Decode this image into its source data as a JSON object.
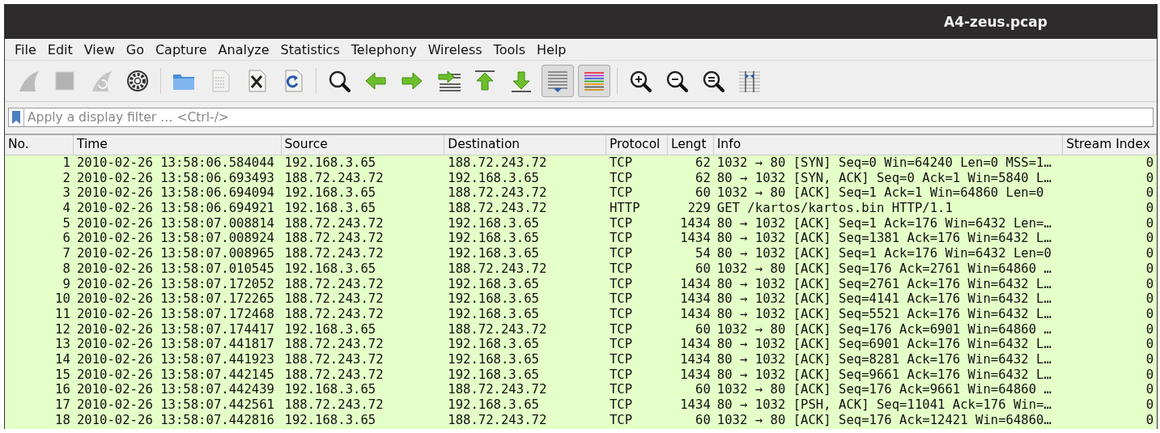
{
  "window": {
    "title": "A4-zeus.pcap"
  },
  "menu": [
    "File",
    "Edit",
    "View",
    "Go",
    "Capture",
    "Analyze",
    "Statistics",
    "Telephony",
    "Wireless",
    "Tools",
    "Help"
  ],
  "toolbar": [
    {
      "kind": "fin",
      "disabled": true,
      "on": false
    },
    {
      "kind": "stop",
      "disabled": true,
      "on": false
    },
    {
      "kind": "restart",
      "disabled": true,
      "on": false
    },
    {
      "kind": "gear",
      "disabled": false,
      "on": false
    },
    {
      "kind": "separator"
    },
    {
      "kind": "folder",
      "disabled": false,
      "on": false
    },
    {
      "kind": "file",
      "disabled": true,
      "on": false
    },
    {
      "kind": "close",
      "disabled": false,
      "on": false
    },
    {
      "kind": "reload",
      "disabled": false,
      "on": false
    },
    {
      "kind": "separator"
    },
    {
      "kind": "search",
      "disabled": false,
      "on": false
    },
    {
      "kind": "back",
      "disabled": false,
      "on": false
    },
    {
      "kind": "forward",
      "disabled": false,
      "on": false
    },
    {
      "kind": "jump",
      "disabled": false,
      "on": false
    },
    {
      "kind": "first",
      "disabled": false,
      "on": false
    },
    {
      "kind": "last",
      "disabled": false,
      "on": false
    },
    {
      "kind": "autoscroll",
      "disabled": false,
      "on": true
    },
    {
      "kind": "colorize",
      "disabled": false,
      "on": true
    },
    {
      "kind": "separator"
    },
    {
      "kind": "zoomin",
      "disabled": false,
      "on": false
    },
    {
      "kind": "zoomout",
      "disabled": false,
      "on": false
    },
    {
      "kind": "zoomreset",
      "disabled": false,
      "on": false
    },
    {
      "kind": "columns",
      "disabled": false,
      "on": false
    }
  ],
  "filter": {
    "placeholder": "Apply a display filter … <Ctrl-/>"
  },
  "table": {
    "columns": [
      "No.",
      "Time",
      "Source",
      "Destination",
      "Protocol",
      "Lengt",
      "Info",
      "Stream Index"
    ],
    "rows": [
      [
        "1",
        "2010-02-26 13:58:06.584044",
        "192.168.3.65",
        "188.72.243.72",
        "TCP",
        "62",
        "1032 → 80 [SYN] Seq=0 Win=64240 Len=0 MSS=1…",
        "0"
      ],
      [
        "2",
        "2010-02-26 13:58:06.693493",
        "188.72.243.72",
        "192.168.3.65",
        "TCP",
        "62",
        "80 → 1032 [SYN, ACK] Seq=0 Ack=1 Win=5840 L…",
        "0"
      ],
      [
        "3",
        "2010-02-26 13:58:06.694094",
        "192.168.3.65",
        "188.72.243.72",
        "TCP",
        "60",
        "1032 → 80 [ACK] Seq=1 Ack=1 Win=64860 Len=0",
        "0"
      ],
      [
        "4",
        "2010-02-26 13:58:06.694921",
        "192.168.3.65",
        "188.72.243.72",
        "HTTP",
        "229",
        "GET /kartos/kartos.bin HTTP/1.1",
        "0"
      ],
      [
        "5",
        "2010-02-26 13:58:07.008814",
        "188.72.243.72",
        "192.168.3.65",
        "TCP",
        "1434",
        "80 → 1032 [ACK] Seq=1 Ack=176 Win=6432 Len=…",
        "0"
      ],
      [
        "6",
        "2010-02-26 13:58:07.008924",
        "188.72.243.72",
        "192.168.3.65",
        "TCP",
        "1434",
        "80 → 1032 [ACK] Seq=1381 Ack=176 Win=6432 L…",
        "0"
      ],
      [
        "7",
        "2010-02-26 13:58:07.008965",
        "188.72.243.72",
        "192.168.3.65",
        "TCP",
        "54",
        "80 → 1032 [ACK] Seq=1 Ack=176 Win=6432 Len=0",
        "0"
      ],
      [
        "8",
        "2010-02-26 13:58:07.010545",
        "192.168.3.65",
        "188.72.243.72",
        "TCP",
        "60",
        "1032 → 80 [ACK] Seq=176 Ack=2761 Win=64860 …",
        "0"
      ],
      [
        "9",
        "2010-02-26 13:58:07.172052",
        "188.72.243.72",
        "192.168.3.65",
        "TCP",
        "1434",
        "80 → 1032 [ACK] Seq=2761 Ack=176 Win=6432 L…",
        "0"
      ],
      [
        "10",
        "2010-02-26 13:58:07.172265",
        "188.72.243.72",
        "192.168.3.65",
        "TCP",
        "1434",
        "80 → 1032 [ACK] Seq=4141 Ack=176 Win=6432 L…",
        "0"
      ],
      [
        "11",
        "2010-02-26 13:58:07.172468",
        "188.72.243.72",
        "192.168.3.65",
        "TCP",
        "1434",
        "80 → 1032 [ACK] Seq=5521 Ack=176 Win=6432 L…",
        "0"
      ],
      [
        "12",
        "2010-02-26 13:58:07.174417",
        "192.168.3.65",
        "188.72.243.72",
        "TCP",
        "60",
        "1032 → 80 [ACK] Seq=176 Ack=6901 Win=64860 …",
        "0"
      ],
      [
        "13",
        "2010-02-26 13:58:07.441817",
        "188.72.243.72",
        "192.168.3.65",
        "TCP",
        "1434",
        "80 → 1032 [ACK] Seq=6901 Ack=176 Win=6432 L…",
        "0"
      ],
      [
        "14",
        "2010-02-26 13:58:07.441923",
        "188.72.243.72",
        "192.168.3.65",
        "TCP",
        "1434",
        "80 → 1032 [ACK] Seq=8281 Ack=176 Win=6432 L…",
        "0"
      ],
      [
        "15",
        "2010-02-26 13:58:07.442145",
        "188.72.243.72",
        "192.168.3.65",
        "TCP",
        "1434",
        "80 → 1032 [ACK] Seq=9661 Ack=176 Win=6432 L…",
        "0"
      ],
      [
        "16",
        "2010-02-26 13:58:07.442439",
        "192.168.3.65",
        "188.72.243.72",
        "TCP",
        "60",
        "1032 → 80 [ACK] Seq=176 Ack=9661 Win=64860 …",
        "0"
      ],
      [
        "17",
        "2010-02-26 13:58:07.442561",
        "188.72.243.72",
        "192.168.3.65",
        "TCP",
        "1434",
        "80 → 1032 [PSH, ACK] Seq=11041 Ack=176 Win=…",
        "0"
      ],
      [
        "18",
        "2010-02-26 13:58:07.442816",
        "192.168.3.65",
        "188.72.243.72",
        "TCP",
        "60",
        "1032 → 80 [ACK] Seq=176 Ack=12421 Win=64860…",
        "0"
      ]
    ]
  }
}
